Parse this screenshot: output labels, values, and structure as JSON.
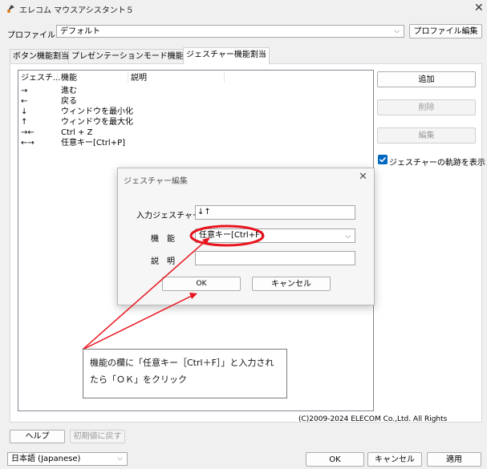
{
  "window": {
    "title": "エレコム マウスアシスタント５"
  },
  "profile": {
    "label": "プロファイル:",
    "value": "デフォルト",
    "edit_button": "プロファイル編集"
  },
  "tabs": [
    {
      "label": "ボタン機能割当"
    },
    {
      "label": "プレゼンテーションモード機能割当"
    },
    {
      "label": "ジェスチャー機能割当"
    }
  ],
  "gesture_table": {
    "headers": [
      "ジェスチ...",
      "機能",
      "説明"
    ],
    "rows": [
      {
        "gesture": "→",
        "function": "進む",
        "description": ""
      },
      {
        "gesture": "←",
        "function": "戻る",
        "description": ""
      },
      {
        "gesture": "↓",
        "function": "ウィンドウを最小化",
        "description": ""
      },
      {
        "gesture": "↑",
        "function": "ウィンドウを最大化",
        "description": ""
      },
      {
        "gesture": "→←",
        "function": "Ctrl + Z",
        "description": ""
      },
      {
        "gesture": "←→",
        "function": "任意キー[Ctrl+P]",
        "description": ""
      }
    ]
  },
  "side_buttons": {
    "add": "追加",
    "delete": "削除",
    "edit": "編集"
  },
  "show_trail": {
    "label": "ジェスチャーの軌跡を表示",
    "checked": true
  },
  "dialog": {
    "title": "ジェスチャー編集",
    "input_label": "入力ジェスチャー",
    "input_value": "↓↑",
    "function_label": "機　能",
    "function_value": "任意キー[Ctrl+F]",
    "description_label": "説　明",
    "description_value": "",
    "ok": "OK",
    "cancel": "キャンセル"
  },
  "annotation": {
    "text": "機能の欄に「任意キー［Ctrl＋F］」と入力されたら「ＯＫ」をクリック",
    "color": "#e8141e"
  },
  "copyright": "(C)2009-2024 ELECOM Co.,Ltd. All Rights",
  "bottom": {
    "help": "ヘルプ",
    "reset": "初期値に戻す",
    "language": "日本語 (Japanese)",
    "ok": "OK",
    "cancel": "キャンセル",
    "apply": "適用"
  }
}
